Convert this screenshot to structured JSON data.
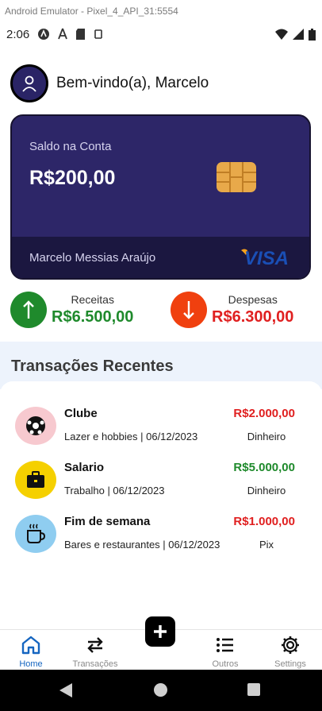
{
  "emulator": {
    "title": "Android Emulator - Pixel_4_API_31:5554"
  },
  "status_bar": {
    "time": "2:06"
  },
  "header": {
    "welcome": "Bem-vindo(a), Marcelo"
  },
  "card": {
    "label": "Saldo na Conta",
    "balance": "R$200,00",
    "holder": "Marcelo  Messias Araújo",
    "brand": "VISA",
    "colors": {
      "card": "#2d2668",
      "footer": "#1b1740",
      "chip": "#e8a94a"
    }
  },
  "summary": {
    "income": {
      "label": "Receitas",
      "value": "R$6.500,00",
      "icon": "arrow-up-icon",
      "color": "#1f8a2c"
    },
    "expense": {
      "label": "Despesas",
      "value": "R$6.300,00",
      "icon": "arrow-down-icon",
      "color": "#f0400f"
    }
  },
  "section": {
    "title": "Transações Recentes"
  },
  "transactions": [
    {
      "title": "Clube",
      "subtitle": "Lazer e hobbies | 06/12/2023",
      "amount": "R$2.000,00",
      "method": "Dinheiro",
      "type": "expense",
      "icon": "soccer-ball-icon",
      "icon_bg": "#f7c9cf"
    },
    {
      "title": "Salario",
      "subtitle": "Trabalho | 06/12/2023",
      "amount": "R$5.000,00",
      "method": "Dinheiro",
      "type": "income",
      "icon": "briefcase-icon",
      "icon_bg": "#f5d000"
    },
    {
      "title": "Fim de semana",
      "subtitle": "Bares e restaurantes | 06/12/2023",
      "amount": "R$1.000,00",
      "method": "Pix",
      "type": "expense",
      "icon": "coffee-cup-icon",
      "icon_bg": "#8fcdf0"
    }
  ],
  "nav": {
    "items": [
      {
        "label": "Home",
        "icon": "home-icon",
        "active": true
      },
      {
        "label": "Transações",
        "icon": "transfer-arrows-icon",
        "active": false
      },
      {
        "label": "Outros",
        "icon": "list-icon",
        "active": false
      },
      {
        "label": "Settings",
        "icon": "gear-icon",
        "active": false
      }
    ],
    "fab_icon": "plus-icon",
    "active_color": "#1565c0"
  }
}
